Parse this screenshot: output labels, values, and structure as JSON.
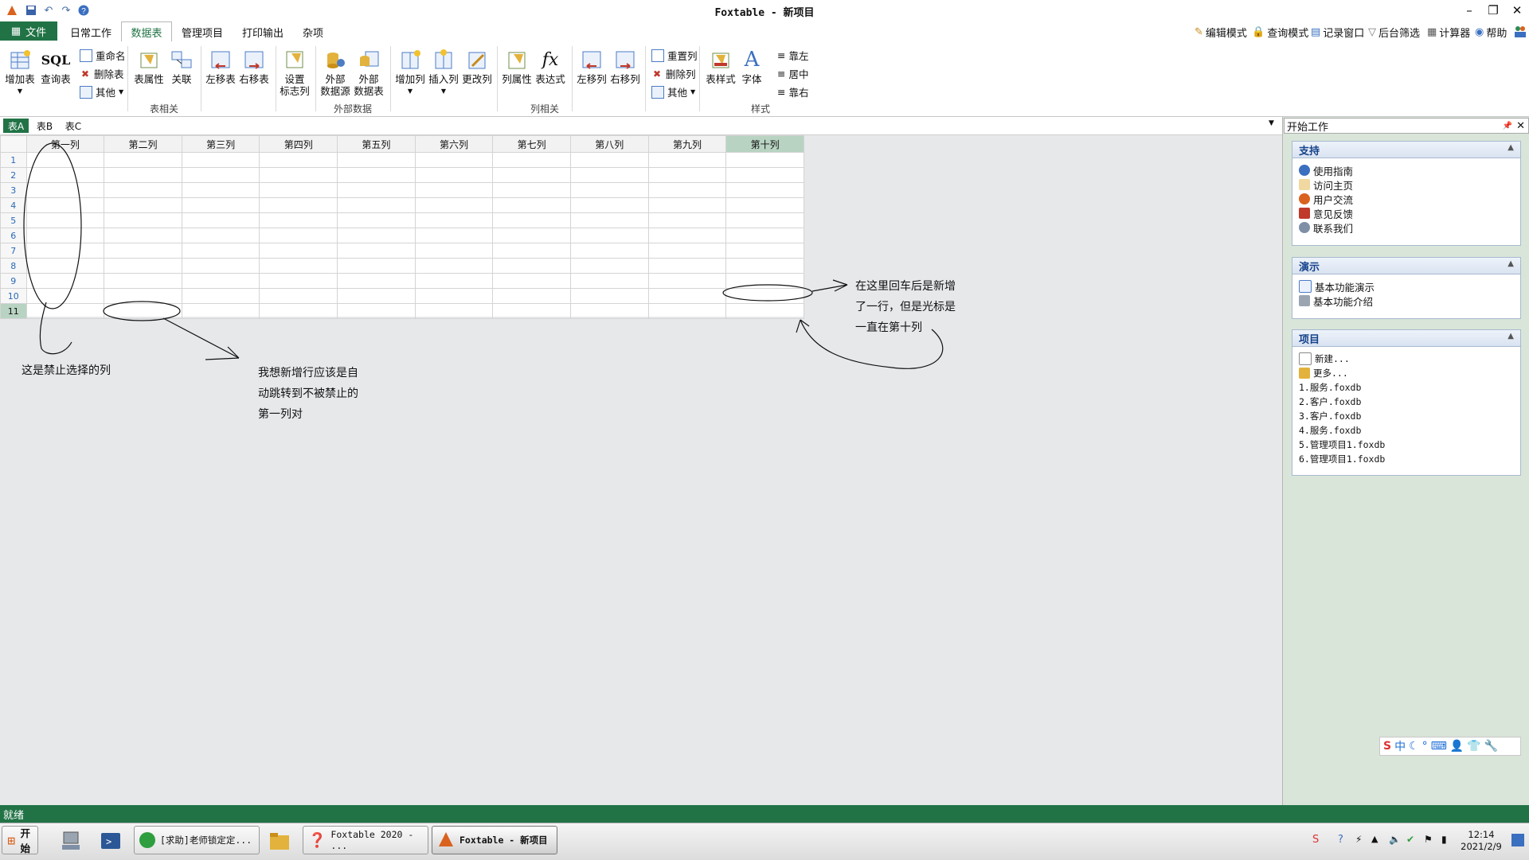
{
  "app": {
    "title": "Foxtable - 新项目"
  },
  "window_buttons": {
    "minimize": "–",
    "restore": "❐",
    "close": "✕"
  },
  "menu": {
    "file": "文件",
    "tabs": [
      "日常工作",
      "数据表",
      "管理项目",
      "打印输出",
      "杂项"
    ],
    "right_links": [
      "编辑模式",
      "查询模式",
      "记录窗口",
      "后台筛选",
      "计算器",
      "帮助"
    ]
  },
  "ribbon": {
    "add_table": "增加表",
    "sql": "SQL",
    "query_table": "查询表",
    "rename": "重命名",
    "delete_table": "删除表",
    "other1": "其他",
    "table_props": "表属性",
    "relation": "关联",
    "move_table_left": "左移表",
    "move_table_right": "右移表",
    "set_flag_col": "设置\n标志列",
    "ext_source": "外部\n数据源",
    "ext_table": "外部\n数据表",
    "add_col": "增加列",
    "insert_col": "插入列",
    "change_col": "更改列",
    "col_props": "列属性",
    "expr": "表达式",
    "fx": "fx",
    "move_col_left": "左移列",
    "move_col_right": "右移列",
    "reset_col": "重置列",
    "delete_col": "删除列",
    "other2": "其他",
    "table_style": "表样式",
    "font": "字体",
    "font_icon": "A",
    "align_left": "靠左",
    "align_center": "居中",
    "align_right": "靠右",
    "groups": {
      "table": "表相关",
      "external": "外部数据",
      "column": "列相关",
      "style": "样式"
    }
  },
  "sheet_tabs": [
    "表A",
    "表B",
    "表C"
  ],
  "grid": {
    "columns": [
      "第一列",
      "第二列",
      "第三列",
      "第四列",
      "第五列",
      "第六列",
      "第七列",
      "第八列",
      "第九列",
      "第十列"
    ],
    "rows": [
      "1",
      "2",
      "3",
      "4",
      "5",
      "6",
      "7",
      "8",
      "9",
      "10",
      "11"
    ]
  },
  "panel": {
    "title": "开始工作",
    "support": {
      "title": "支持",
      "items": [
        "使用指南",
        "访问主页",
        "用户交流",
        "意见反馈",
        "联系我们"
      ]
    },
    "demo": {
      "title": "演示",
      "items": [
        "基本功能演示",
        "基本功能介绍"
      ]
    },
    "project": {
      "title": "项目",
      "items": [
        "新建...",
        "更多...",
        "1.服务.foxdb",
        "2.客户.foxdb",
        "3.客户.foxdb",
        "4.服务.foxdb",
        "5.管理项目1.foxdb",
        "6.管理项目1.foxdb"
      ]
    }
  },
  "notes": {
    "note1": "这是禁止选择的列",
    "note2": [
      "我想新增行应该是自",
      "动跳转到不被禁止的",
      "第一列对"
    ],
    "note3": [
      "在这里回车后是新增",
      "了一行，但是光标是",
      "一直在第十列"
    ]
  },
  "status": "就绪",
  "taskbar": {
    "start": "开始",
    "items": [
      "[求助]老师锁定定...",
      "Foxtable 2020 - ...",
      "Foxtable - 新项目"
    ],
    "time": "12:14",
    "date": "2021/2/9"
  },
  "ime": {
    "label": "中"
  },
  "colors": {
    "accent": "#217346",
    "selected_col": "#b8d3c2"
  }
}
